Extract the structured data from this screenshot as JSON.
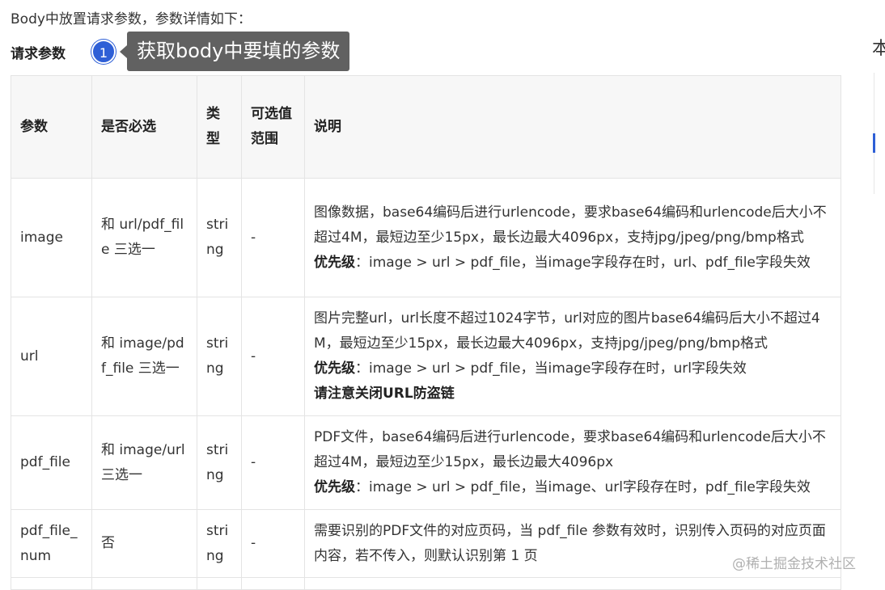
{
  "intro": "Body中放置请求参数，参数详情如下：",
  "section_label": "请求参数",
  "marker": "1",
  "tooltip": "获取body中要填的参数",
  "right_glyph": "本",
  "table": {
    "headers": [
      "参数",
      "是否必选",
      "类型",
      "可选值范围",
      "说明"
    ],
    "rows": [
      {
        "param": "image",
        "required": "和 url/pdf_file 三选一",
        "type": "string",
        "range": "-",
        "desc": "图像数据，base64编码后进行urlencode，要求base64编码和urlencode后大小不超过4M，最短边至少15px，最长边最大4096px，支持jpg/jpeg/png/bmp格式",
        "prio_label": "优先级",
        "prio_text": "：image > url > pdf_file，当image字段存在时，url、pdf_file字段失效"
      },
      {
        "param": "url",
        "required": "和 image/pdf_file 三选一",
        "type": "string",
        "range": "-",
        "desc": "图片完整url，url长度不超过1024字节，url对应的图片base64编码后大小不超过4M，最短边至少15px，最长边最大4096px，支持jpg/jpeg/png/bmp格式",
        "prio_label": "优先级",
        "prio_text": "：image > url > pdf_file，当image字段存在时，url字段失效",
        "note": "请注意关闭URL防盗链"
      },
      {
        "param": "pdf_file",
        "required": "和 image/url 三选一",
        "type": "string",
        "range": "-",
        "desc": "PDF文件，base64编码后进行urlencode，要求base64编码和urlencode后大小不超过4M，最短边至少15px，最长边最大4096px",
        "prio_label": "优先级",
        "prio_text": "：image > url > pdf_file，当image、url字段存在时，pdf_file字段失效"
      },
      {
        "param": "pdf_file_num",
        "required": "否",
        "type": "string",
        "range": "-",
        "desc": "需要识别的PDF文件的对应页码，当 pdf_file 参数有效时，识别传入页码的对应页面内容，若不传入，则默认识别第 1 页"
      }
    ]
  },
  "watermark": "@稀土掘金技术社区"
}
